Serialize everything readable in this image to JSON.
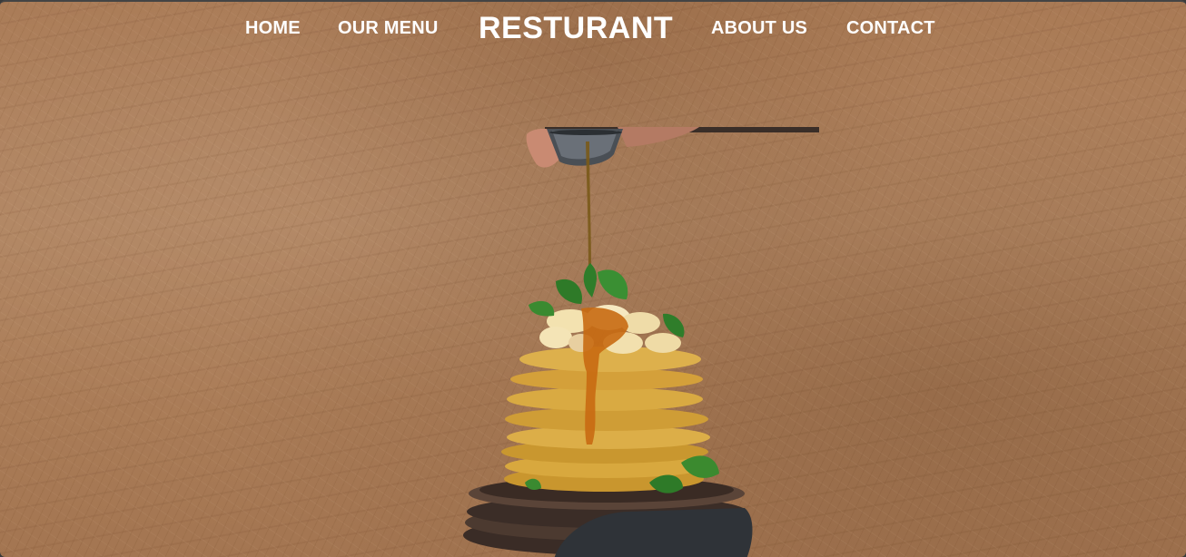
{
  "nav": {
    "home": "HOME",
    "menu": "OUR MENU",
    "brand": "RESTURANT",
    "about": "ABOUT US",
    "contact": "CONTACT"
  },
  "hero": {
    "image_icon": "pancake-stack-image"
  },
  "colors": {
    "background": "#a97a55",
    "nav_text": "#ffffff"
  }
}
